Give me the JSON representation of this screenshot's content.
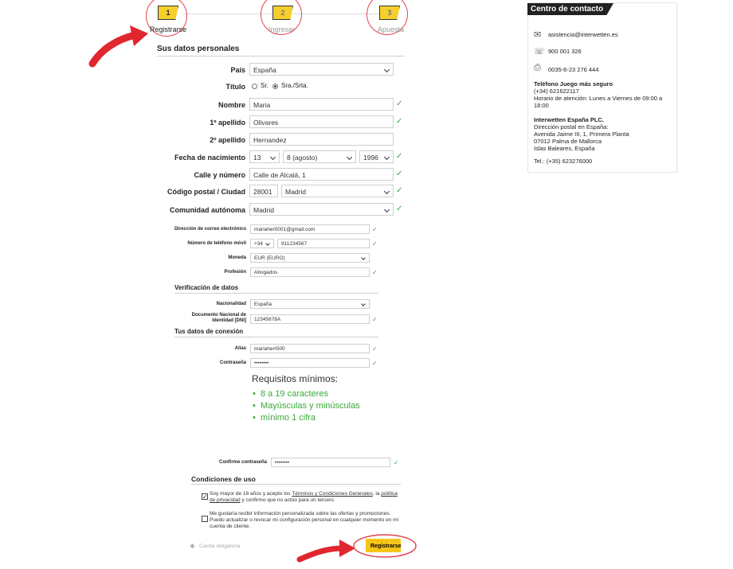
{
  "steps": [
    {
      "num": "1",
      "label": "Registrarse"
    },
    {
      "num": "2",
      "label": "Ingresar"
    },
    {
      "num": "3",
      "label": "Apuesta"
    }
  ],
  "sections": {
    "personal": "Sus datos personales",
    "verify": "Verificación de datos",
    "conn": "Tus datos de conexión",
    "conditions": "Condiciones de uso"
  },
  "form": {
    "pais": {
      "label": "País",
      "value": "España"
    },
    "titulo": {
      "label": "Título",
      "opt1": "Sr.",
      "opt2": "Sra./Srta."
    },
    "nombre": {
      "label": "Nombre",
      "value": "Maria"
    },
    "apellido1": {
      "label": "1º apellido",
      "value": "Olivares"
    },
    "apellido2": {
      "label": "2º apellido",
      "value": "Hernandez"
    },
    "nacimiento": {
      "label": "Fecha de nacimiento",
      "day": "13",
      "month": "8 (agosto)",
      "year": "1996"
    },
    "calle": {
      "label": "Calle y número",
      "value": "Calle de Alcalá, 1"
    },
    "cp": {
      "label": "Código postal / Ciudad",
      "cp": "28001",
      "ciudad": "Madrid"
    },
    "comunidad": {
      "label": "Comunidad autónoma",
      "value": "Madrid"
    },
    "email": {
      "label": "Dirección de correo electrónico",
      "value": "mariaher0001@gmail.com"
    },
    "telefono": {
      "label": "Número de teléfono móvil",
      "prefix": "+34",
      "value": "911234567"
    },
    "moneda": {
      "label": "Moneda",
      "value": "EUR (EURO)"
    },
    "profesion": {
      "label": "Profesión",
      "value": "Abogados"
    },
    "nacionalidad": {
      "label": "Nacionalidad",
      "value": "España"
    },
    "dni": {
      "label1": "Documento Nacional de",
      "label2": "Identidad [DNI]",
      "value": "12345678A"
    },
    "alias": {
      "label": "Alias",
      "value": "mariaherr500"
    },
    "password": {
      "label": "Contraseña",
      "value": "••••••••"
    },
    "confirm": {
      "label": "Confirme contraseña",
      "value": "••••••••"
    }
  },
  "requirements": {
    "title": "Requisitos mínimos:",
    "items": [
      "8 a 19 caracteres",
      "Mayúsculas y minúsculas",
      "mínimo 1 cifra"
    ]
  },
  "terms": {
    "t1a": "Soy mayor de 18 años y acepto los ",
    "t1link1": "Términos y Condiciones Generales",
    "t1b": ", la ",
    "t1link2": "política de privacidad",
    "t1c": " y confirmo que no actúo para un tercero.",
    "t2": "Me gustaría recibir información personalizada sobre las ofertas y promociones. Puedo actualizar o revocar mi configuración personal en cualquier momento en mi cuenta de cliente."
  },
  "footer": {
    "mandatory": "Casilla obligatoria",
    "register": "Registrarse"
  },
  "contact": {
    "title": "Centro de contacto",
    "email": "asistencia@interwetten.es",
    "phone": "900 001 326",
    "fax": "0035-6-23 276 444",
    "secure_title": "Teléfono Juego más seguro",
    "secure_phone": "(+34) 621622117",
    "hours": "Horario de atención: Lunes a Viernes de 09:00 a 18:00",
    "company": "Interwetten España PLC.",
    "addr1": "Dirección postal en España:",
    "addr2": "Avenida Jaime III, 1, Primera Planta",
    "addr3": "07012 Palma de Mallorca",
    "addr4": "Islas Baleares, España",
    "tel": "Tel.: (+35) 623276000"
  }
}
